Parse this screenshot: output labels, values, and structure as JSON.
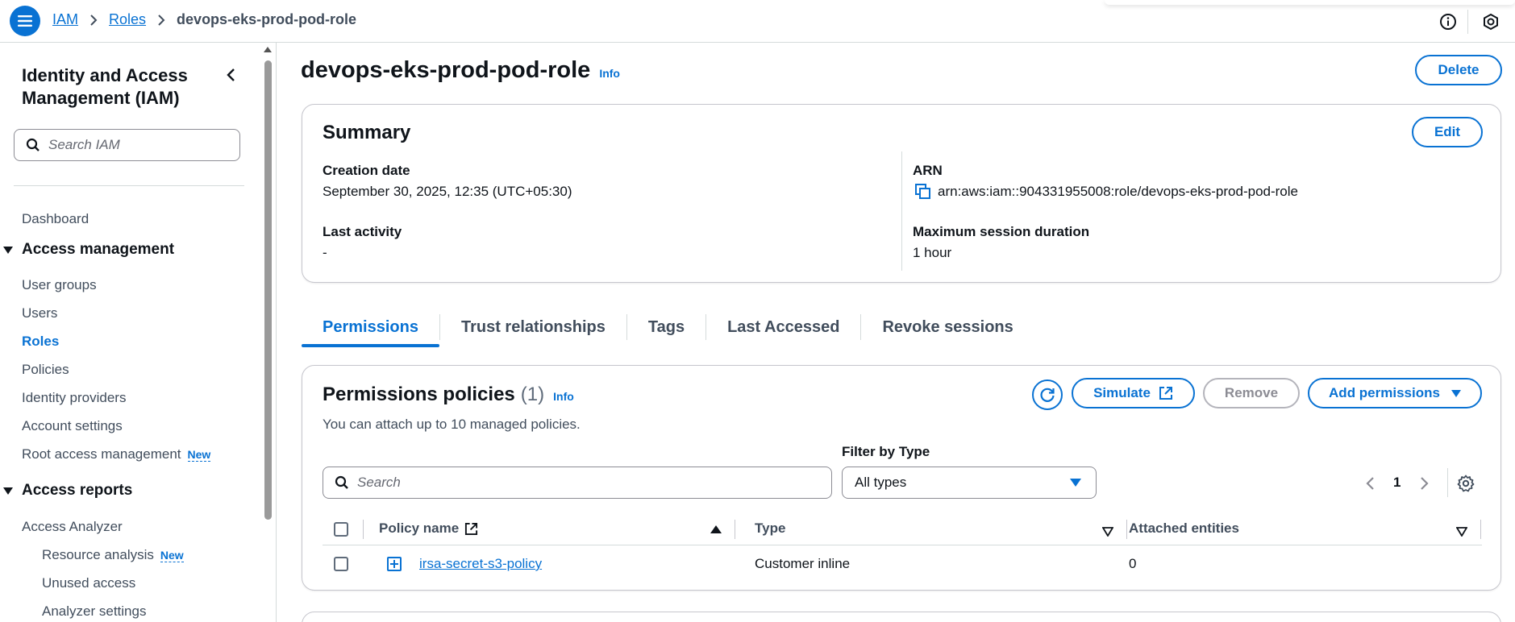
{
  "breadcrumb": {
    "items": [
      "IAM",
      "Roles"
    ],
    "current": "devops-eks-prod-pod-role"
  },
  "icons": {
    "menu": "hamburger-menu-icon",
    "info": "info-circle-icon",
    "settings": "hexagon-settings-icon"
  },
  "sidebar": {
    "title": "Identity and Access Management (IAM)",
    "search_placeholder": "Search IAM",
    "dashboard": "Dashboard",
    "sections": {
      "access_management": "Access management",
      "access_reports": "Access reports"
    },
    "items": {
      "user_groups": "User groups",
      "users": "Users",
      "roles": "Roles",
      "policies": "Policies",
      "identity_providers": "Identity providers",
      "account_settings": "Account settings",
      "root_access_management": "Root access management",
      "access_analyzer": "Access Analyzer",
      "resource_analysis": "Resource analysis",
      "unused_access": "Unused access",
      "analyzer_settings": "Analyzer settings"
    },
    "new_badge": "New"
  },
  "page": {
    "title": "devops-eks-prod-pod-role",
    "info": "Info",
    "delete_label": "Delete"
  },
  "summary": {
    "heading": "Summary",
    "edit_label": "Edit",
    "creation_date_label": "Creation date",
    "creation_date_value": "September 30, 2025, 12:35 (UTC+05:30)",
    "last_activity_label": "Last activity",
    "last_activity_value": "-",
    "arn_label": "ARN",
    "arn_value": "arn:aws:iam::904331955008:role/devops-eks-prod-pod-role",
    "max_session_label": "Maximum session duration",
    "max_session_value": "1 hour"
  },
  "tabs": [
    "Permissions",
    "Trust relationships",
    "Tags",
    "Last Accessed",
    "Revoke sessions"
  ],
  "permissions": {
    "title": "Permissions policies",
    "count": "(1)",
    "info": "Info",
    "description": "You can attach up to 10 managed policies.",
    "simulate_label": "Simulate",
    "remove_label": "Remove",
    "add_permissions_label": "Add permissions",
    "filter_label": "Filter by Type",
    "search_placeholder": "Search",
    "filter_value": "All types",
    "page_number": "1",
    "columns": {
      "policy_name": "Policy name",
      "type": "Type",
      "attached_entities": "Attached entities"
    },
    "rows": [
      {
        "policy_name": "irsa-secret-s3-policy",
        "type": "Customer inline",
        "attached_entities": "0"
      }
    ]
  },
  "colors": {
    "accent": "#0972d3",
    "text": "#0f141a",
    "muted": "#414d5c",
    "border": "#c6c6cd"
  }
}
